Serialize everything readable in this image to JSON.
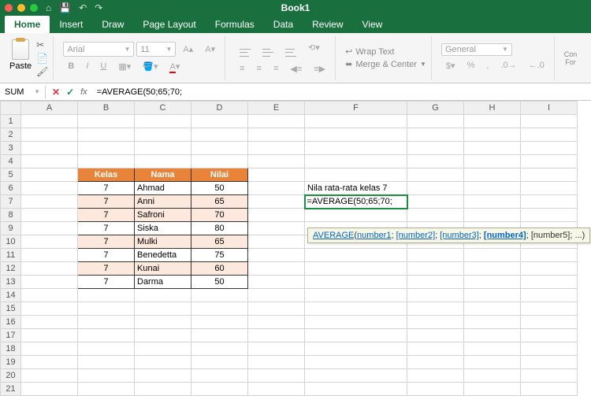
{
  "title": "Book1",
  "tabs": [
    "Home",
    "Insert",
    "Draw",
    "Page Layout",
    "Formulas",
    "Data",
    "Review",
    "View"
  ],
  "paste": "Paste",
  "font": {
    "name": "Arial",
    "size": "11"
  },
  "wrap": "Wrap Text",
  "merge": "Merge & Center",
  "numfmt": "General",
  "cond": "Con\nFor",
  "namebox": "SUM",
  "formula": "=AVERAGE(50;65;70;",
  "cols": [
    "A",
    "B",
    "C",
    "D",
    "E",
    "F",
    "G",
    "H",
    "I"
  ],
  "header": {
    "kelas": "Kelas",
    "nama": "Nama",
    "nilai": "Nilai"
  },
  "rows": [
    {
      "k": "7",
      "n": "Ahmad",
      "v": "50"
    },
    {
      "k": "7",
      "n": "Anni",
      "v": "65"
    },
    {
      "k": "7",
      "n": "Safroni",
      "v": "70"
    },
    {
      "k": "7",
      "n": "Siska",
      "v": "80"
    },
    {
      "k": "7",
      "n": "Mulki",
      "v": "65"
    },
    {
      "k": "7",
      "n": "Benedetta",
      "v": "75"
    },
    {
      "k": "7",
      "n": "Kunai",
      "v": "60"
    },
    {
      "k": "7",
      "n": "Darma",
      "v": "50"
    }
  ],
  "f6": "Nila rata-rata kelas 7",
  "f7": "=AVERAGE(50;65;70;",
  "tt": {
    "fn": "AVERAGE",
    "p1": "number1",
    "p2": "[number2]",
    "p3": "[number3]",
    "p4": "[number4]",
    "p5": "[number5]; ...",
    "o": "(",
    "s": "; ",
    "c": ")"
  }
}
